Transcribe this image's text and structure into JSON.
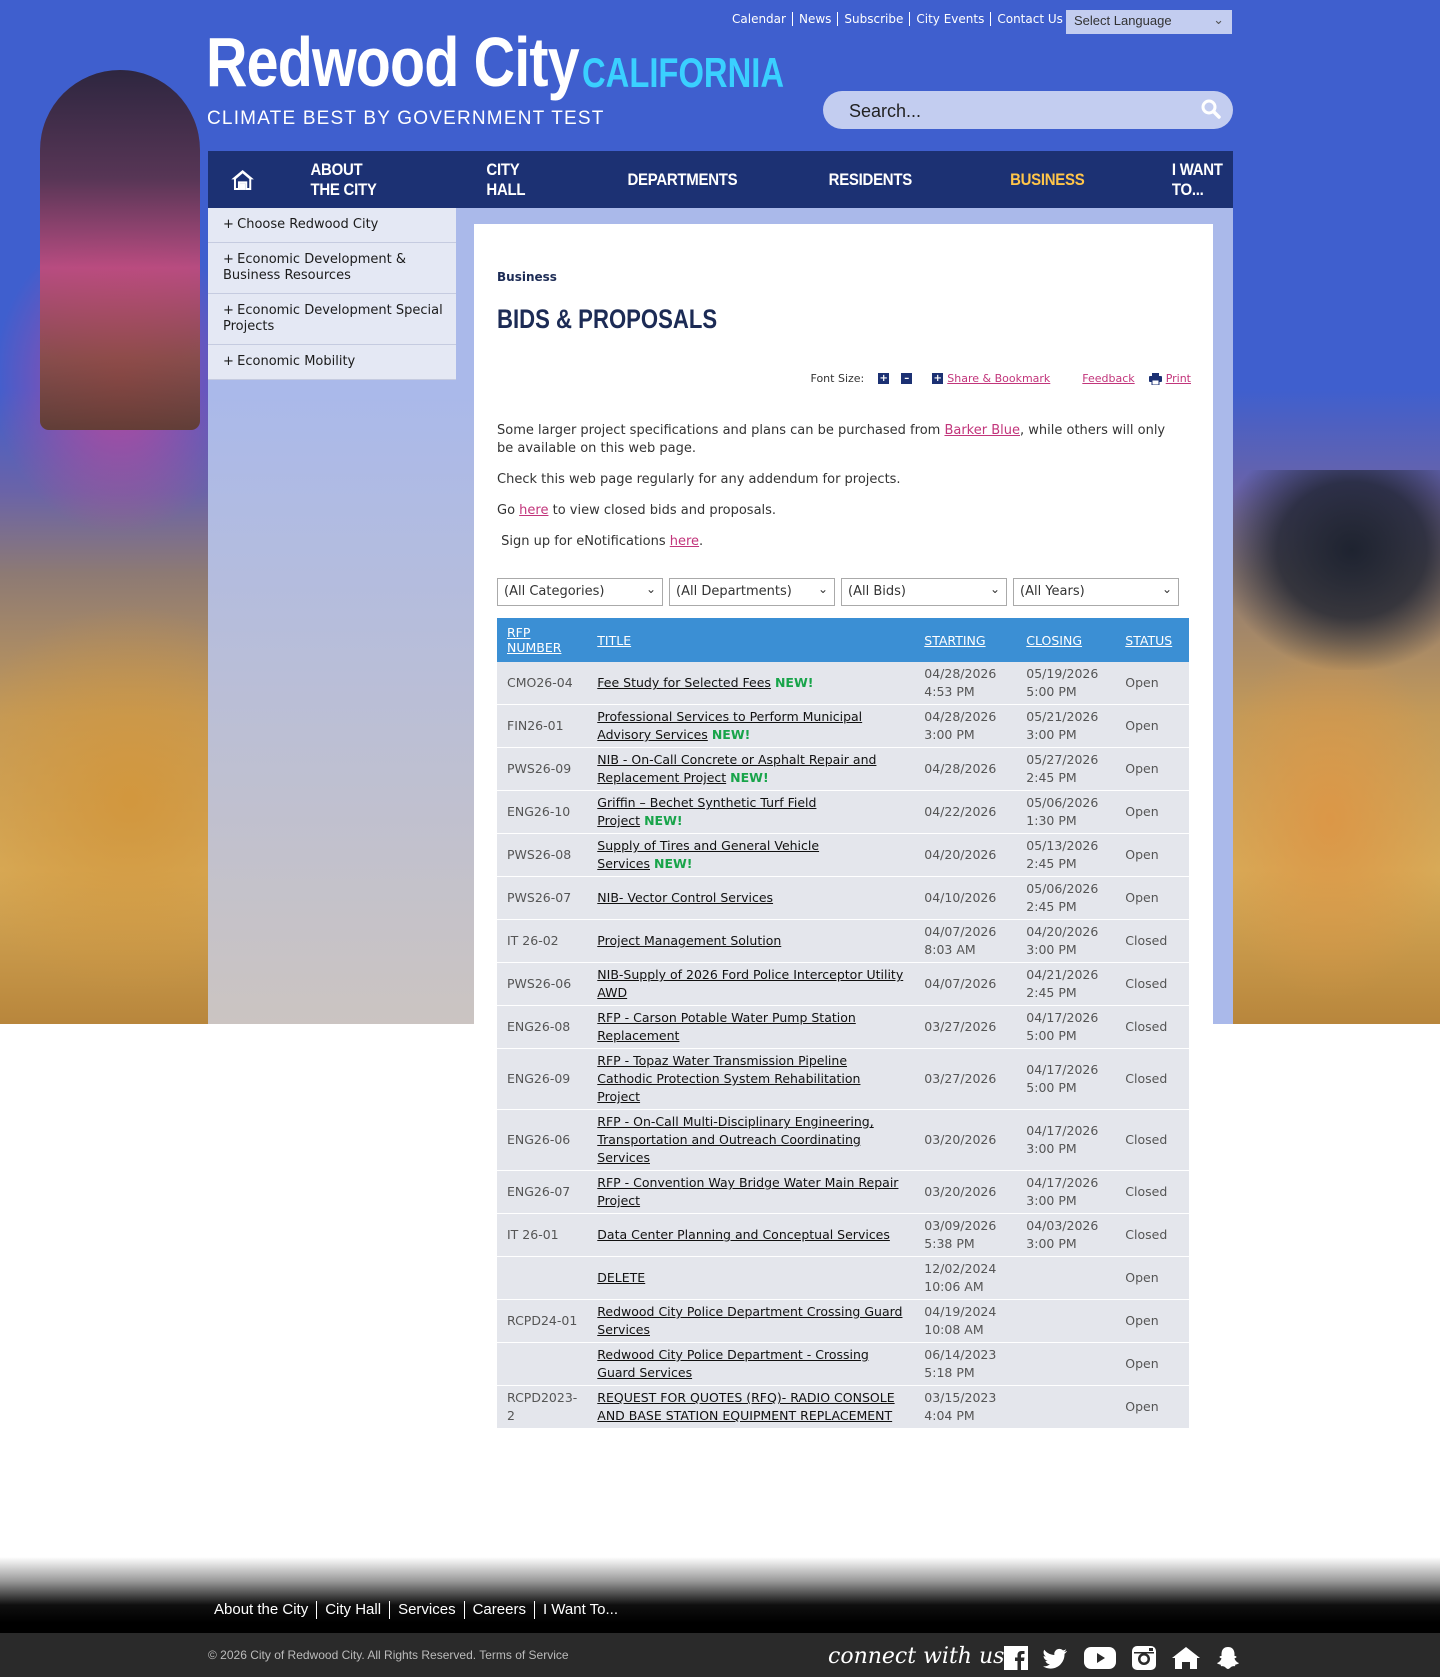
{
  "utility_links": [
    "Calendar",
    "News",
    "Subscribe",
    "City Events",
    "Contact Us"
  ],
  "language_select": "Select Language",
  "logo": {
    "title": "Redwood City",
    "state": "CALIFORNIA",
    "tagline": "CLIMATE BEST BY GOVERNMENT TEST"
  },
  "search": {
    "placeholder": "Search..."
  },
  "nav": [
    "ABOUT THE CITY",
    "CITY HALL",
    "DEPARTMENTS",
    "RESIDENTS",
    "BUSINESS",
    "I WANT TO..."
  ],
  "nav_active": "BUSINESS",
  "sidebar": [
    "Choose Redwood City",
    "Economic Development & Business Resources",
    "Economic Development Special Projects",
    "Economic Mobility"
  ],
  "breadcrumb": "Business",
  "page_title": "BIDS & PROPOSALS",
  "tools": {
    "font_size": "Font Size:",
    "share": "Share & Bookmark",
    "feedback": "Feedback",
    "print": "Print"
  },
  "intro": {
    "p1_before": "Some larger project specifications and plans can be purchased from ",
    "p1_link": "Barker Blue",
    "p1_after": ", while others will only be available on this web page.",
    "p2": "Check this web page regularly for any addendum for projects.",
    "p3_before": "Go ",
    "p3_link": "here",
    "p3_after": " to view closed bids and proposals.",
    "p4_before": " Sign up for eNotifications ",
    "p4_link": "here",
    "p4_after": "."
  },
  "filters": [
    "(All Categories)",
    "(All Departments)",
    "(All Bids)",
    "(All Years)"
  ],
  "table": {
    "headers": [
      "RFP NUMBER",
      "TITLE",
      "STARTING",
      "CLOSING",
      "STATUS"
    ],
    "new_label": "NEW!",
    "rows": [
      {
        "num": "CMO26-04",
        "title": "Fee Study for Selected Fees",
        "new": true,
        "start": "04/28/2026 4:53 PM",
        "close": "05/19/2026 5:00 PM",
        "status": "Open"
      },
      {
        "num": "FIN26-01",
        "title": "Professional Services to Perform Municipal Advisory Services",
        "new": true,
        "start": "04/28/2026 3:00 PM",
        "close": "05/21/2026 3:00 PM",
        "status": "Open"
      },
      {
        "num": "PWS26-09",
        "title": "NIB - On-Call Concrete or Asphalt Repair and Replacement Project",
        "new": true,
        "start": "04/28/2026",
        "close": "05/27/2026 2:45 PM",
        "status": "Open"
      },
      {
        "num": "ENG26-10",
        "title": "Griffin – Bechet Synthetic Turf Field Project",
        "new": true,
        "start": "04/22/2026",
        "close": "05/06/2026 1:30 PM",
        "status": "Open"
      },
      {
        "num": "PWS26-08",
        "title": "Supply of Tires and General Vehicle Services",
        "new": true,
        "start": "04/20/2026",
        "close": "05/13/2026 2:45 PM",
        "status": "Open"
      },
      {
        "num": "PWS26-07",
        "title": "NIB- Vector Control Services",
        "new": false,
        "start": "04/10/2026",
        "close": "05/06/2026 2:45 PM",
        "status": "Open"
      },
      {
        "num": "IT 26-02",
        "title": "Project Management Solution",
        "new": false,
        "start": "04/07/2026 8:03 AM",
        "close": "04/20/2026 3:00 PM",
        "status": "Closed"
      },
      {
        "num": "PWS26-06",
        "title": "NIB-Supply of 2026 Ford Police Interceptor Utility AWD",
        "new": false,
        "start": "04/07/2026",
        "close": "04/21/2026 2:45 PM",
        "status": "Closed"
      },
      {
        "num": "ENG26-08",
        "title": "RFP - Carson Potable Water Pump Station Replacement",
        "new": false,
        "start": "03/27/2026",
        "close": "04/17/2026 5:00 PM",
        "status": "Closed"
      },
      {
        "num": "ENG26-09",
        "title": "RFP - Topaz Water Transmission Pipeline Cathodic Protection System Rehabilitation Project",
        "new": false,
        "start": "03/27/2026",
        "close": "04/17/2026 5:00 PM",
        "status": "Closed"
      },
      {
        "num": "ENG26-06",
        "title": "RFP - On-Call Multi-Disciplinary Engineering, Transportation and Outreach Coordinating Services",
        "new": false,
        "start": "03/20/2026",
        "close": "04/17/2026 3:00 PM",
        "status": "Closed"
      },
      {
        "num": "ENG26-07",
        "title": "RFP - Convention Way Bridge Water Main Repair Project",
        "new": false,
        "start": "03/20/2026",
        "close": "04/17/2026 3:00 PM",
        "status": "Closed"
      },
      {
        "num": "IT 26-01",
        "title": "Data Center Planning and Conceptual Services",
        "new": false,
        "start": "03/09/2026 5:38 PM",
        "close": "04/03/2026 3:00 PM",
        "status": "Closed"
      },
      {
        "num": "",
        "title": "DELETE",
        "new": false,
        "start": "12/02/2024 10:06 AM",
        "close": "",
        "status": "Open"
      },
      {
        "num": "RCPD24-01",
        "title": "Redwood City Police Department Crossing Guard Services",
        "new": false,
        "start": "04/19/2024 10:08 AM",
        "close": "",
        "status": "Open"
      },
      {
        "num": "",
        "title": "Redwood City Police Department - Crossing Guard Services",
        "new": false,
        "start": "06/14/2023 5:18 PM",
        "close": "",
        "status": "Open"
      },
      {
        "num": "RCPD2023-2",
        "title": "REQUEST FOR QUOTES (RFQ)- RADIO CONSOLE AND BASE STATION EQUIPMENT REPLACEMENT",
        "new": false,
        "start": "03/15/2023 4:04 PM",
        "close": "",
        "status": "Open"
      }
    ]
  },
  "footer": {
    "links": [
      "About the City",
      "City Hall",
      "Services",
      "Careers",
      "I Want To..."
    ],
    "copyright": "© 2026 City of Redwood City. All Rights Reserved. Terms of Service",
    "connect": "connect with us",
    "social_icons": [
      "facebook-icon",
      "twitter-icon",
      "youtube-icon",
      "instagram-icon",
      "nextdoor-icon",
      "snapchat-icon"
    ]
  },
  "colors": {
    "header_bg": "#3f5fce",
    "nav_bg": "#1c3173",
    "nav_active": "#ffc54a",
    "table_header": "#3b8fd4",
    "link_pink": "#c2357b",
    "new_green": "#18a44a"
  }
}
